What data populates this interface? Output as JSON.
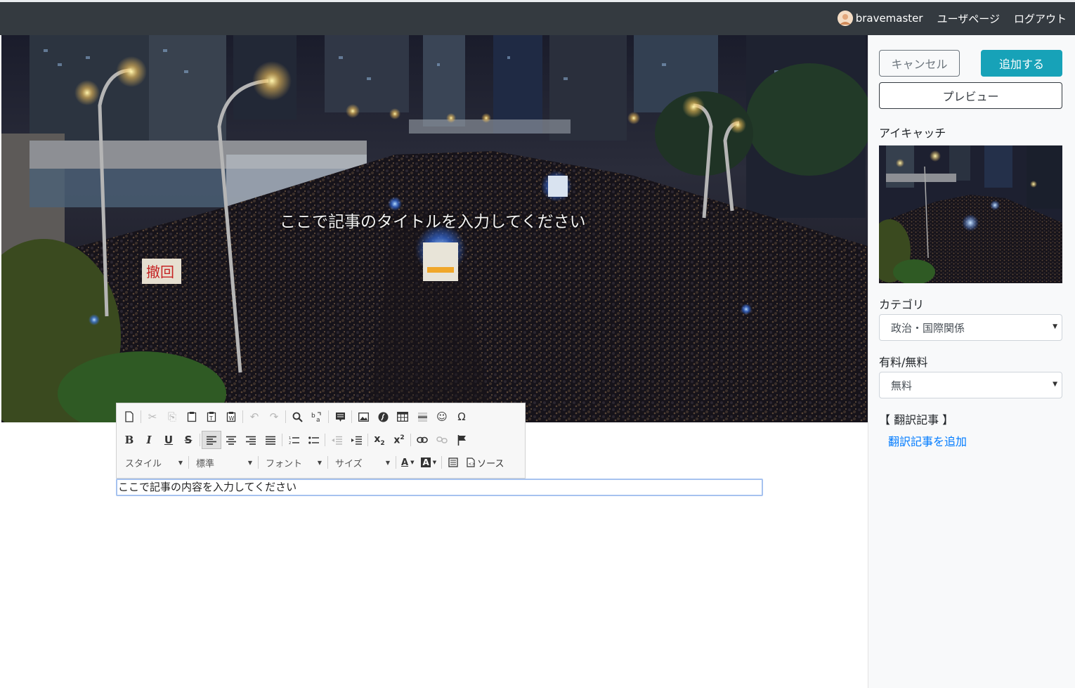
{
  "navbar": {
    "username": "bravemaster",
    "user_page": "ユーザページ",
    "logout": "ログアウト"
  },
  "hero": {
    "title_placeholder": "ここで記事のタイトルを入力してください"
  },
  "editor": {
    "toolbar": {
      "style_combo": "スタイル",
      "format_combo": "標準",
      "font_combo": "フォント",
      "size_combo": "サイズ",
      "source_label": "ソース"
    },
    "content_placeholder": "ここで記事の内容を入力してください"
  },
  "sidebar": {
    "cancel_label": "キャンセル",
    "add_label": "追加する",
    "preview_label": "プレビュー",
    "eyecatch_label": "アイキャッチ",
    "category_label": "カテゴリ",
    "category_value": "政治・国際関係",
    "paid_label": "有料/無料",
    "paid_value": "無料",
    "translation_label": "【 翻訳記事 】",
    "translation_link": "翻訳記事を追加"
  },
  "colors": {
    "navbar_bg": "#343a40",
    "accent": "#17a2b8",
    "link": "#007bff"
  }
}
